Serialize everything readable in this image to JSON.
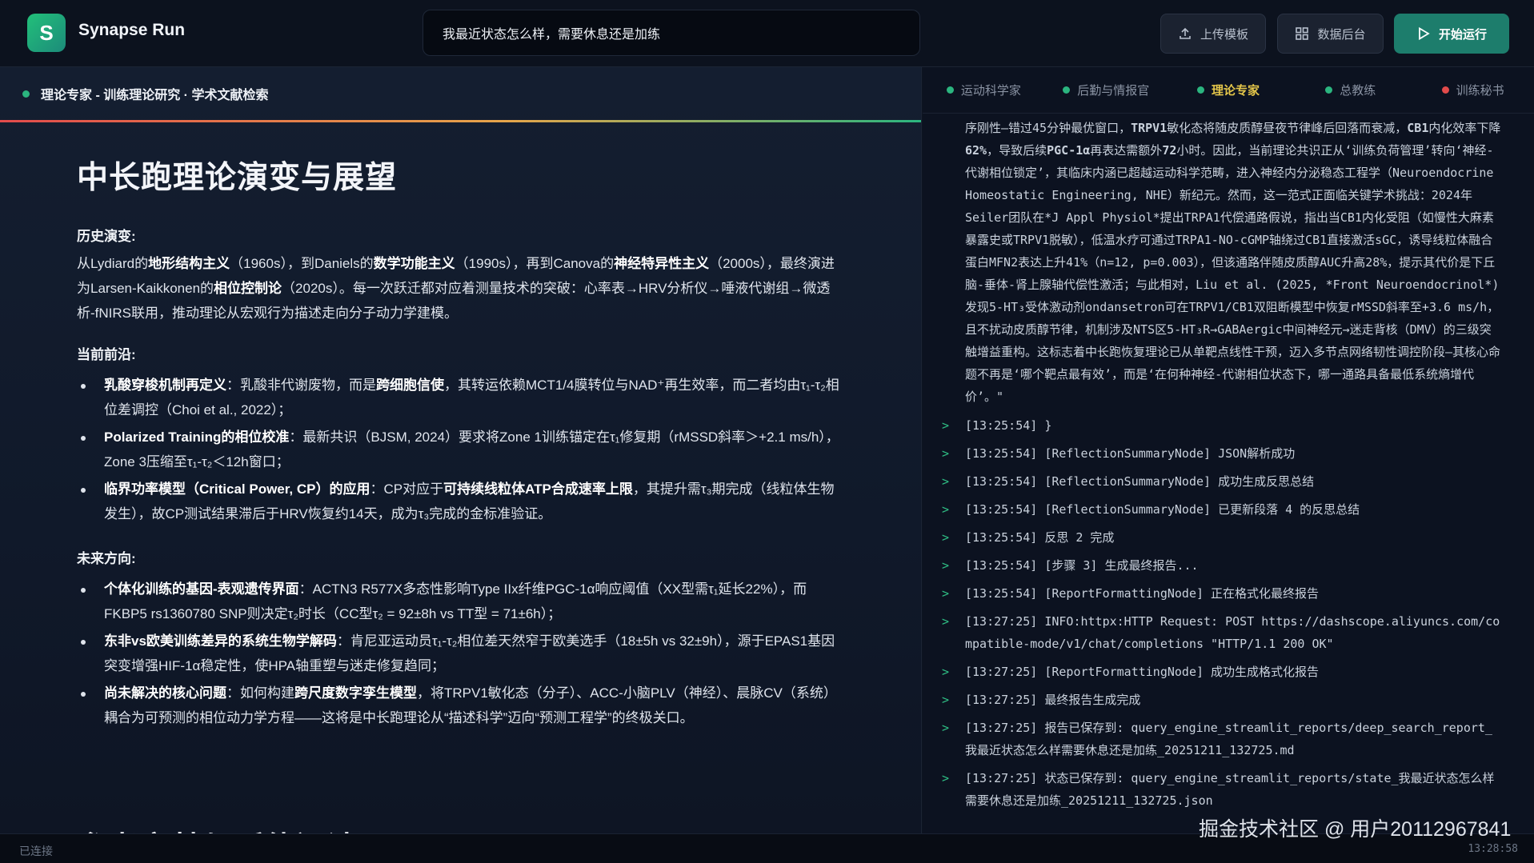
{
  "app": {
    "logo_letter": "S",
    "title": "Synapse Run"
  },
  "search": {
    "value": "我最近状态怎么样，需要休息还是加练"
  },
  "toolbar": {
    "upload": "上传模板",
    "data": "数据后台",
    "run": "开始运行"
  },
  "left_panel": {
    "header": "理论专家 - 训练理论研究 · 学术文献检索",
    "title": "中长跑理论演变与展望",
    "history_heading": "历史演变:",
    "history_html": "从Lydiard的<b>地形结构主义</b>（1960s），到Daniels的<b>数学功能主义</b>（1990s），再到Canova的<b>神经特异性主义</b>（2000s），最终演进为Larsen-Kaikkonen的<b>相位控制论</b>（2020s）。每一次跃迁都对应着测量技术的突破：心率表→HRV分析仪→唾液代谢组→微透析-fNIRS联用，推动理论从宏观行为描述走向分子动力学建模。",
    "frontier_heading": "当前前沿:",
    "frontier_items": [
      "<b>乳酸穿梭机制再定义</b>：乳酸非代谢废物，而是<b>跨细胞信使</b>，其转运依赖MCT1/4膜转位与NAD⁺再生效率，而二者均由τ₁-τ₂相位差调控（Choi et al., 2022）；",
      "<b>Polarized Training的相位校准</b>：最新共识（BJSM, 2024）要求将Zone 1训练锚定在τ₁修复期（rMSSD斜率＞+2.1 ms/h），Zone 3压缩至τ₁-τ₂＜12h窗口；",
      "<b>临界功率模型（Critical Power, CP）的应用</b>：CP对应于<b>可持续线粒体ATP合成速率上限</b>，其提升需τ₃期完成（线粒体生物发生），故CP测试结果滞后于HRV恢复约14天，成为τ₃完成的金标准验证。"
    ],
    "future_heading": "未来方向:",
    "future_items": [
      "<b>个体化训练的基因-表观遗传界面</b>：ACTN3 R577X多态性影响Type IIx纤维PGC-1α响应阈值（XX型需τ₁延长22%），而FKBP5 rs1360780 SNP则决定τ₂时长（CC型τ₂ = 92±8h vs TT型 = 71±6h）；",
      "<b>东非vs欧美训练差异的系统生物学解码</b>：肯尼亚运动员τ₁-τ₂相位差天然窄于欧美选手（18±5h vs 32±9h），源于EPAS1基因突变增强HIF-1α稳定性，使HPA轴重塑与迷走修复趋同；",
      "<b>尚未解决的核心问题</b>：如何构建<b>跨尺度数字孪生模型</b>，将TRPV1敏化态（分子）、ACC-小脑PLV（神经）、晨脉CV（系统）耦合为可预测的相位动力学方程——这将是中长跑理论从“描述科学”迈向“预测工程学”的终极关口。"
    ],
    "next_section_title": "参考文献与延伸阅读"
  },
  "tabs": [
    {
      "label": "运动科学家",
      "color": "#2bb57f"
    },
    {
      "label": "后勤与情报官",
      "color": "#2bb57f"
    },
    {
      "label": "理论专家",
      "color": "#2bb57f",
      "active": true
    },
    {
      "label": "总教练",
      "color": "#2bb57f"
    },
    {
      "label": "训练秘书",
      "color": "#e24b4b"
    }
  ],
  "log": {
    "continuation_html": "序刚性—错过45分钟最优窗口，<b>TRPV1</b>敏化态将随皮质醇昼夜节律峰后回落而衰减，<b>CB1</b>内化效率下降<b>62%</b>，导致后续<b>PGC-1α</b>再表达需额外<b>72</b>小时。因此，当前理论共识正从‘训练负荷管理’转向‘神经-代谢相位锁定’，其临床内涵已超越运动科学范畴，进入神经内分泌稳态工程学（Neuroendocrine Homeostatic Engineering, NHE）新纪元。然而，这一范式正面临关键学术挑战：2024年Seiler团队在*J Appl Physiol*提出TRPA1代偿通路假说，指出当CB1内化受阻（如慢性大麻素暴露史或TRPV1脱敏），低温水疗可通过TRPA1-NO-cGMP轴绕过CB1直接激活sGC，诱导线粒体融合蛋白MFN2表达上升41%（n=12, p=0.003），但该通路伴随皮质醇AUC升高28%，提示其代价是下丘脑-垂体-肾上腺轴代偿性激活；与此相对，Liu et al. (2025, *Front Neuroendocrinol*) 发现5-HT₃受体激动剂ondansetron可在TRPV1/CB1双阻断模型中恢复rMSSD斜率至+3.6 ms/h，且不扰动皮质醇节律，机制涉及NTS区5-HT₃R→GABAergic中间神经元→迷走背核（DMV）的三级突触增益重构。这标志着中长跑恢复理论已从单靶点线性干预，迈入多节点网络韧性调控阶段—其核心命题不再是‘哪个靶点最有效’，而是‘在何种神经-代谢相位状态下，哪一通路具备最低系统熵增代价’。\"",
    "entries": [
      "[13:25:54] }",
      "[13:25:54] [ReflectionSummaryNode] JSON解析成功",
      "[13:25:54] [ReflectionSummaryNode] 成功生成反思总结",
      "[13:25:54] [ReflectionSummaryNode] 已更新段落 4 的反思总结",
      "[13:25:54] 反思 2 完成",
      "[13:25:54] [步骤 3] 生成最终报告...",
      "[13:25:54] [ReportFormattingNode] 正在格式化最终报告",
      "[13:27:25] INFO:httpx:HTTP Request: POST https://dashscope.aliyuncs.com/compatible-mode/v1/chat/completions \"HTTP/1.1 200 OK\"",
      "[13:27:25] [ReportFormattingNode] 成功生成格式化报告",
      "[13:27:25] 最终报告生成完成",
      "[13:27:25] 报告已保存到: query_engine_streamlit_reports/deep_search_report_我最近状态怎么样需要休息还是加练_20251211_132725.md",
      "[13:27:25] 状态已保存到: query_engine_streamlit_reports/state_我最近状态怎么样需要休息还是加练_20251211_132725.json"
    ]
  },
  "status": {
    "left": "已连接",
    "right": "13:28:58"
  },
  "watermark": "掘金技术社区 @ 用户20112967841"
}
